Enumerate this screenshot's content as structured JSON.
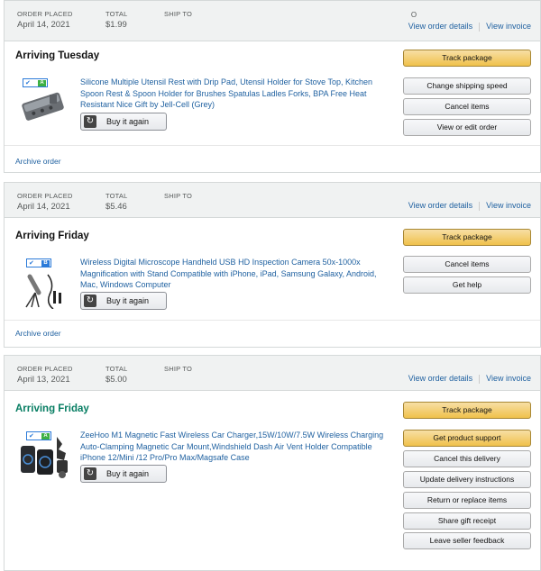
{
  "orders": [
    {
      "order_placed_label": "ORDER PLACED",
      "order_placed": "April 14, 2021",
      "total_label": "TOTAL",
      "total": "$1.99",
      "ship_to_label": "SHIP TO",
      "status_small": "O",
      "view_order_details": "View order details",
      "view_invoice": "View invoice",
      "shipment_status": "Arriving Tuesday",
      "item_title": "Silicone Multiple Utensil Rest with Drip Pad, Utensil Holder for Stove Top, Kitchen Spoon Rest & Spoon Holder for Brushes Spatulas Ladles Forks, BPA Free Heat Resistant Nice Gift by Jell-Cell (Grey)",
      "badge_letter": "A",
      "badge_color": "#3cb043",
      "buy_again": "Buy it again",
      "actions": [
        "Track package",
        "Change shipping speed",
        "Cancel items",
        "View or edit order"
      ],
      "archive": "Archive order"
    },
    {
      "order_placed_label": "ORDER PLACED",
      "order_placed": "April 14, 2021",
      "total_label": "TOTAL",
      "total": "$5.46",
      "ship_to_label": "SHIP TO",
      "view_order_details": "View order details",
      "view_invoice": "View invoice",
      "shipment_status": "Arriving Friday",
      "item_title": "Wireless Digital Microscope Handheld USB HD Inspection Camera 50x-1000x Magnification with Stand Compatible with iPhone, iPad, Samsung Galaxy, Android, Mac, Windows Computer",
      "badge_letter": "B",
      "badge_color": "#2c7bd9",
      "buy_again": "Buy it again",
      "actions": [
        "Track package",
        "Cancel items",
        "Get help"
      ],
      "archive": "Archive order"
    },
    {
      "order_placed_label": "ORDER PLACED",
      "order_placed": "April 13, 2021",
      "total_label": "TOTAL",
      "total": "$5.00",
      "ship_to_label": "SHIP TO",
      "view_order_details": "View order details",
      "view_invoice": "View invoice",
      "shipment_status": "Arriving Friday",
      "item_title": "ZeeHoo M1 Magnetic Fast Wireless Car Charger,15W/10W/7.5W Wireless Charging Auto-Clamping Magnetic Car Mount,Windshield Dash Air Vent Holder Compatible iPhone 12/Mini /12 Pro/Pro Max/Magsafe Case",
      "badge_letter": "A",
      "badge_color": "#3cb043",
      "buy_again": "Buy it again",
      "actions": [
        "Track package",
        "Get product support",
        "Cancel this delivery",
        "Update delivery instructions",
        "Return or replace items",
        "Share gift receipt",
        "Leave seller feedback"
      ]
    }
  ],
  "colors": {
    "link": "#2162a1",
    "arriving_green": "#067d62",
    "header_bg": "#f0f2f2",
    "button_yellow": "#f0c14b"
  }
}
